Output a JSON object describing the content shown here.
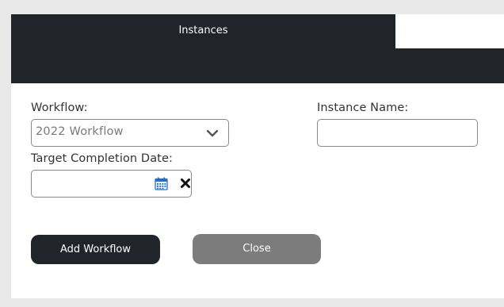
{
  "dialog": {
    "tab_title": "Instances"
  },
  "form": {
    "workflow_label": "Workflow:",
    "workflow_selected": "2022 Workflow",
    "instance_name_label": "Instance Name:",
    "instance_name_value": "",
    "target_date_label": "Target Completion Date:",
    "target_date_value": ""
  },
  "buttons": {
    "add_label": "Add Workflow",
    "close_label": "Close"
  },
  "icons": {
    "select": "chevron-down-icon",
    "date_picker": "calendar-icon",
    "clear": "close-icon"
  },
  "colors": {
    "header_bg": "#212428",
    "primary_button": "#212428",
    "secondary_button": "#7c7c7c",
    "calendar_icon": "#1e6fd9"
  }
}
